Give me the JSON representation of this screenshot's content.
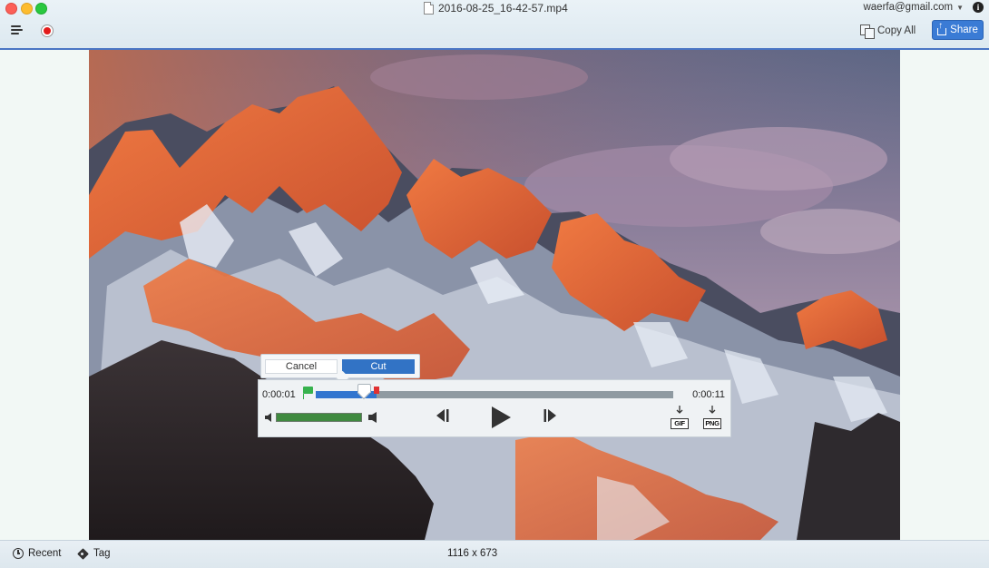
{
  "window": {
    "title": "2016-08-25_16-42-57.mp4",
    "account": "waerfa@gmail.com"
  },
  "toolbar": {
    "copy_all_label": "Copy All",
    "share_label": "Share"
  },
  "trim": {
    "cancel_label": "Cancel",
    "cut_label": "Cut"
  },
  "player": {
    "current_time": "0:00:01",
    "end_time": "0:00:11",
    "selection_start": 0.0,
    "selection_end": 0.17,
    "playhead_position": 0.135,
    "volume": 1.0,
    "export_gif_label": "GIF",
    "export_png_label": "PNG"
  },
  "statusbar": {
    "recent_label": "Recent",
    "tag_label": "Tag",
    "dimensions": "1116 x 673"
  },
  "colors": {
    "accent": "#3273c5",
    "selection": "#3275cf",
    "volume": "#3f8a3f",
    "in_marker": "#37b24d",
    "out_marker": "#e03131",
    "record": "#e31b1b"
  },
  "icons": {
    "menu": "hamburger-icon",
    "record": "record-icon",
    "copy": "copy-icon",
    "share": "share-icon",
    "info": "info-icon",
    "recent": "clock-icon",
    "tag": "tag-icon"
  }
}
